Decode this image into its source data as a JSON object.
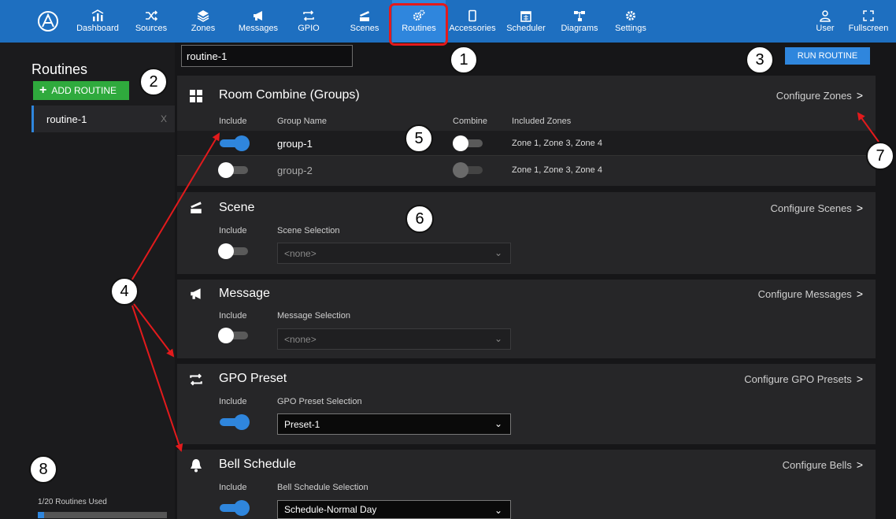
{
  "nav": {
    "items": [
      {
        "label": "Dashboard",
        "icon": "dashboard-icon"
      },
      {
        "label": "Sources",
        "icon": "shuffle-icon"
      },
      {
        "label": "Zones",
        "icon": "layers-icon"
      },
      {
        "label": "Messages",
        "icon": "megaphone-icon"
      },
      {
        "label": "GPIO",
        "icon": "swap-icon"
      },
      {
        "label": "Scenes",
        "icon": "clapper-icon"
      },
      {
        "label": "Routines",
        "icon": "cogs-icon"
      },
      {
        "label": "Accessories",
        "icon": "device-icon"
      },
      {
        "label": "Scheduler",
        "icon": "calendar-icon"
      },
      {
        "label": "Diagrams",
        "icon": "diagram-icon"
      },
      {
        "label": "Settings",
        "icon": "gear-icon"
      }
    ],
    "user": "User",
    "fullscreen": "Fullscreen",
    "active": "Routines"
  },
  "sidebar": {
    "title": "Routines",
    "add_label": "ADD ROUTINE",
    "routines": [
      {
        "name": "routine-1",
        "delete": "X"
      }
    ],
    "usage_text": "1/20 Routines Used",
    "usage_fraction": 0.05
  },
  "main": {
    "routine_name": "routine-1",
    "run_label": "RUN ROUTINE",
    "room_combine": {
      "title": "Room Combine (Groups)",
      "configure": "Configure Zones",
      "col_include": "Include",
      "col_group": "Group Name",
      "col_combine": "Combine",
      "col_zones": "Included Zones",
      "groups": [
        {
          "name": "group-1",
          "include": true,
          "combine": false,
          "zones": "Zone 1, Zone 3, Zone 4"
        },
        {
          "name": "group-2",
          "include": false,
          "combine": false,
          "zones": "Zone 1, Zone 3, Zone 4"
        }
      ]
    },
    "scene": {
      "title": "Scene",
      "configure": "Configure Scenes",
      "col_include": "Include",
      "col_selection": "Scene Selection",
      "include": false,
      "selection": "<none>"
    },
    "message": {
      "title": "Message",
      "configure": "Configure Messages",
      "col_include": "Include",
      "col_selection": "Message Selection",
      "include": false,
      "selection": "<none>"
    },
    "gpo": {
      "title": "GPO Preset",
      "configure": "Configure GPO Presets",
      "col_include": "Include",
      "col_selection": "GPO Preset Selection",
      "include": true,
      "selection": "Preset-1"
    },
    "bell": {
      "title": "Bell Schedule",
      "configure": "Configure Bells",
      "col_include": "Include",
      "col_selection": "Bell Schedule Selection",
      "include": true,
      "selection": "Schedule-Normal Day"
    }
  },
  "callouts": [
    "1",
    "2",
    "3",
    "4",
    "5",
    "6",
    "7",
    "8"
  ],
  "colors": {
    "nav": "#1e6fc0",
    "accent": "#2f86dd",
    "add": "#2faa3d",
    "annotation": "#e31a1c"
  }
}
